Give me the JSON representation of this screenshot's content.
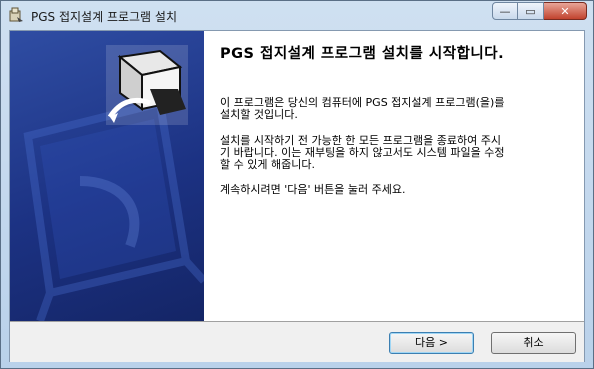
{
  "window": {
    "title": "PGS 접지설계 프로그램 설치",
    "icons": {
      "app": "installer-icon",
      "minimize": "minimize-icon",
      "maximize": "maximize-icon",
      "close": "close-icon"
    },
    "minimize_glyph": "—",
    "maximize_glyph": "▭",
    "close_glyph": "✕"
  },
  "banner": {
    "icon": "installer-box-icon"
  },
  "content": {
    "heading": "PGS 접지설계 프로그램 설치를 시작합니다.",
    "para1_line1": "이 프로그램은 당신의 컴퓨터에 PGS 접지설계 프로그램(을)를",
    "para1_line2": "설치할 것입니다.",
    "para2_line1": "설치를 시작하기 전 가능한 한 모든 프로그램을 종료하여 주시",
    "para2_line2": "기 바랍니다. 이는 재부팅을 하지 않고서도 시스템 파일을 수정",
    "para2_line3": "할 수 있게 해줍니다.",
    "para3": "계속하시려면 '다음' 버튼을 눌러 주세요."
  },
  "buttons": {
    "next": "다음 >",
    "cancel": "취소"
  },
  "colors": {
    "banner": "#1c3283",
    "close_button": "#c1432e"
  }
}
